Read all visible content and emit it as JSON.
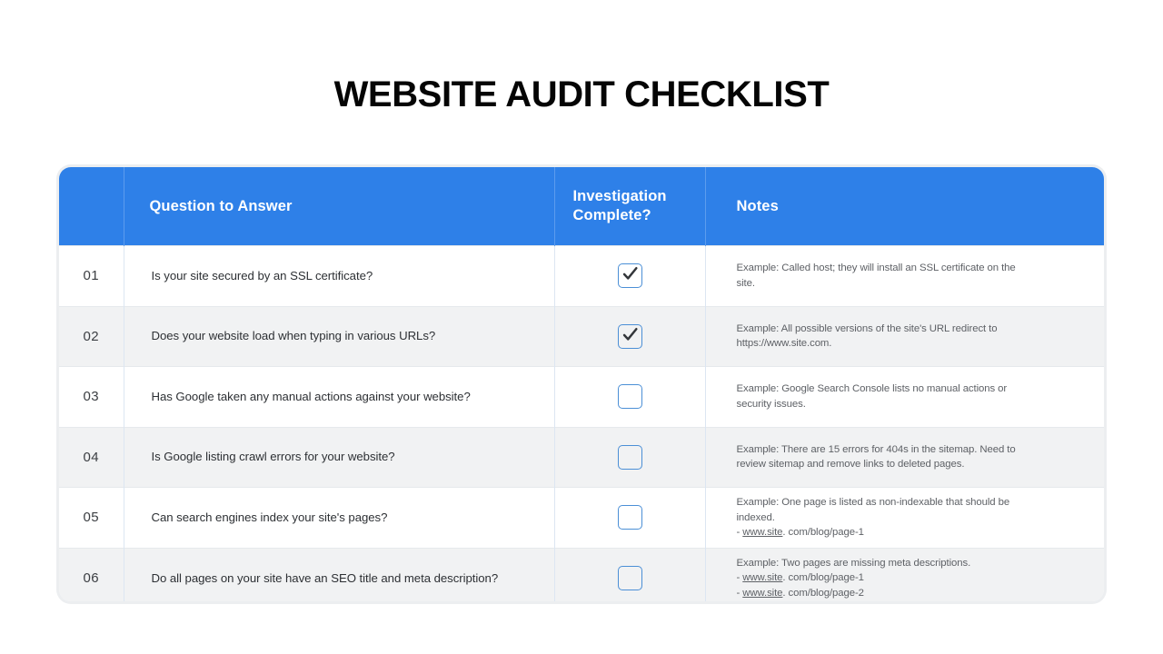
{
  "page": {
    "title": "WEBSITE AUDIT CHECKLIST",
    "background_color": "#ffffff",
    "accent_color": "#2e80e8",
    "stripe_color": "#f1f2f3",
    "frame_color": "#eceef0",
    "checkbox_border_color": "#4b8fd6"
  },
  "table": {
    "headers": {
      "number": "",
      "question": "Question to Answer",
      "investigation": "Investigation\nComplete?",
      "investigation_line1": "Investigation",
      "investigation_line2": "Complete?",
      "notes": "Notes"
    },
    "rows": [
      {
        "number": "01",
        "question": "Is your site secured by an SSL certificate?",
        "checked": true,
        "notes_lines": [
          {
            "text": "Example: Called host; they will install an SSL certificate on the"
          },
          {
            "text": "site."
          }
        ]
      },
      {
        "number": "02",
        "question": "Does your website load when typing in various URLs?",
        "checked": true,
        "notes_lines": [
          {
            "text": "Example: All possible versions of the site's URL redirect to"
          },
          {
            "text": "https://www.site.com."
          }
        ]
      },
      {
        "number": "03",
        "question": "Has Google taken any manual actions against your website?",
        "checked": false,
        "notes_lines": [
          {
            "text": "Example: Google Search Console lists no manual actions or"
          },
          {
            "text": "security issues."
          }
        ]
      },
      {
        "number": "04",
        "question": "Is Google listing crawl errors for your website?",
        "checked": false,
        "notes_lines": [
          {
            "text": "Example: There are 15 errors for 404s in the sitemap. Need to"
          },
          {
            "text": "review sitemap and remove links to deleted pages."
          }
        ]
      },
      {
        "number": "05",
        "question": "Can search engines index your site's pages?",
        "checked": false,
        "notes_lines": [
          {
            "text": "Example: One page is listed as non-indexable that should be"
          },
          {
            "text": "indexed."
          },
          {
            "prefix": "- ",
            "link": "www.site",
            "suffix": ". com/blog/page-1"
          }
        ]
      },
      {
        "number": "06",
        "question": "Do all pages on your site have an SEO title and meta description?",
        "checked": false,
        "notes_lines": [
          {
            "text": "Example: Two pages are missing meta descriptions."
          },
          {
            "prefix": "- ",
            "link": "www.site",
            "suffix": ". com/blog/page-1"
          },
          {
            "prefix": "- ",
            "link": "www.site",
            "suffix": ". com/blog/page-2"
          }
        ]
      }
    ]
  }
}
